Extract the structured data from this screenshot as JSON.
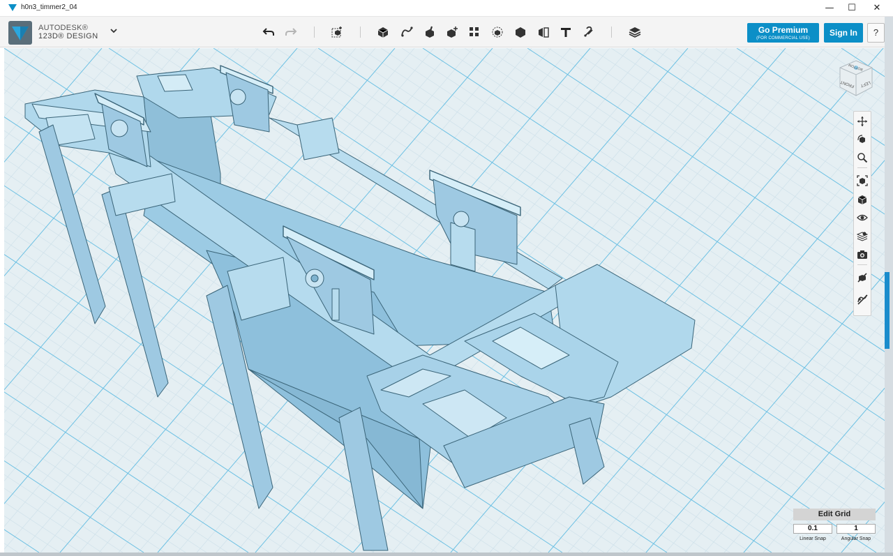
{
  "window": {
    "title": "h0n3_timmer2_04",
    "minimize_glyph": "—",
    "maximize_glyph": "☐",
    "close_glyph": "✕"
  },
  "brand": {
    "line1": "AUTODESK®",
    "line2": "123D® DESIGN",
    "accent": "#0c8fc7"
  },
  "toolbar": {
    "tools": [
      "undo-icon",
      "redo-icon",
      "transform-icon",
      "primitives-icon",
      "sketch-icon",
      "construct-icon",
      "modify-icon",
      "pattern-icon",
      "grouping-icon",
      "combine-icon",
      "measure-icon",
      "text-icon",
      "snap-icon",
      "material-icon"
    ]
  },
  "account": {
    "premium_label": "Go Premium",
    "premium_sub": "(FOR COMMERCIAL USE)",
    "signin_label": "Sign In",
    "help_label": "?"
  },
  "viewcube": {
    "faces": [
      "BOTTOM",
      "LEFT",
      "FRONT"
    ]
  },
  "navbar": {
    "tools": [
      "pan-icon",
      "orbit-icon",
      "zoom-icon",
      "fit-icon",
      "view-mode-icon",
      "visibility-icon",
      "material-toggle-icon",
      "screenshot-icon",
      "grid-snap-icon",
      "sketch-visibility-icon"
    ]
  },
  "grid": {
    "edit_label": "Edit Grid",
    "linear_snap_value": "0.1",
    "angular_snap_value": "1",
    "linear_snap_label": "Linear Snap",
    "angular_snap_label": "Angular Snap"
  },
  "colors": {
    "model_fill": "#a9d3ea",
    "model_edge": "#2f5466",
    "grid_minor": "#cfe1ea",
    "grid_major": "#5fb9e0",
    "viewport_bg": "#e5eff3"
  }
}
